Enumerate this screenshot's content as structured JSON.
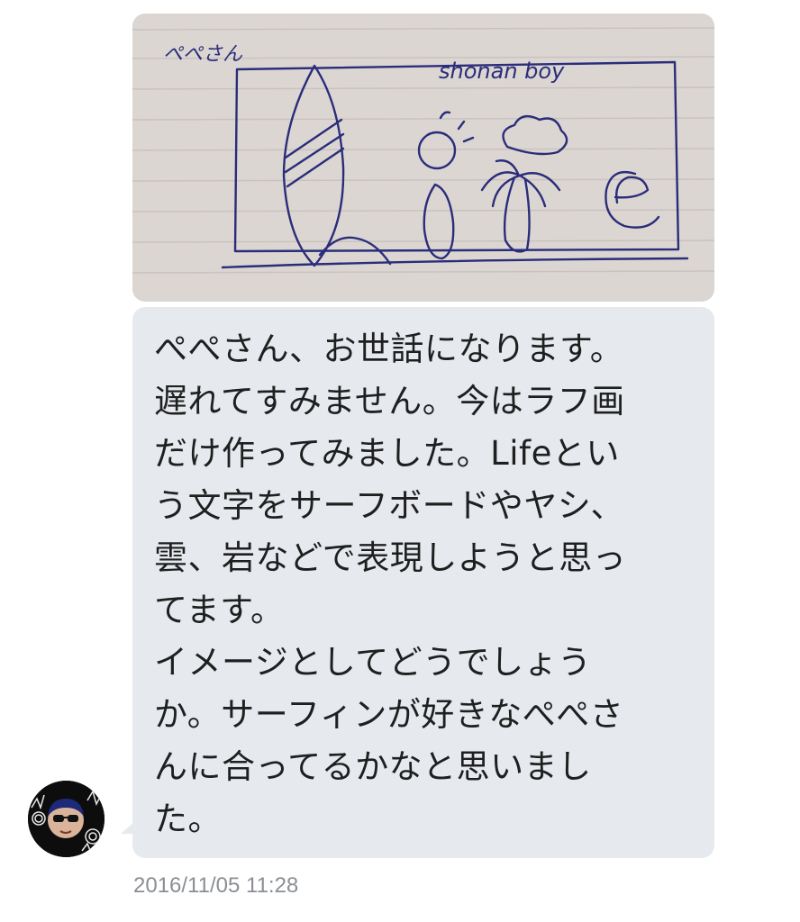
{
  "photo": {
    "sketch_label_name": "ぺぺさん",
    "sketch_label_title": "shonan boy"
  },
  "message": {
    "lines": [
      "ぺぺさん、お世話になります。",
      "遅れてすみません。今はラフ画",
      "だけ作ってみました。Lifeとい",
      "う文字をサーフボードやヤシ、",
      "雲、岩などで表現しようと思っ",
      "てます。",
      "イメージとしてどうでしょう",
      "か。サーフィンが好きなぺぺさ",
      "んに合ってるかなと思いまし",
      "た。"
    ]
  },
  "timestamp": "2016/11/05 11:28",
  "colors": {
    "bubble": "#e6eaef",
    "text": "#1f1f1f",
    "timestamp": "#8b8f94",
    "ink": "#2a2d7a"
  }
}
